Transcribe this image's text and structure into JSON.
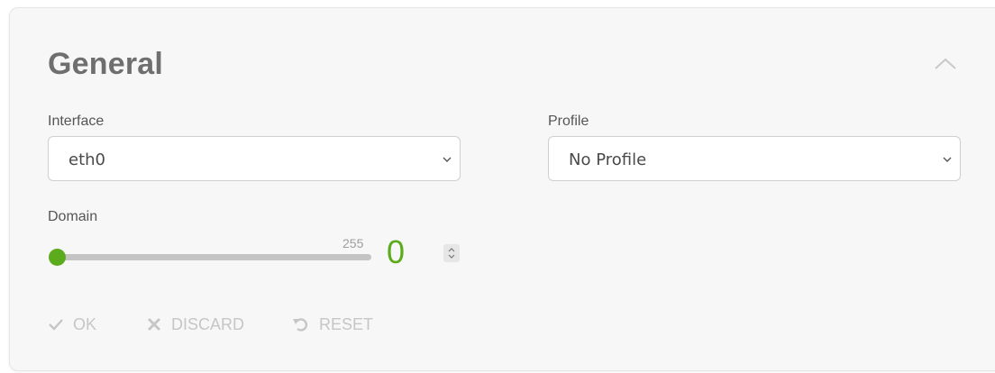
{
  "section": {
    "title": "General"
  },
  "icons": {
    "collapse": "chevron-up-icon",
    "dropdown": "chevron-down-icon",
    "stepper": "up-down-stepper-icon",
    "ok": "checkmark-icon",
    "discard": "x-icon",
    "reset": "undo-icon"
  },
  "interface_field": {
    "label": "Interface",
    "value": "eth0"
  },
  "profile_field": {
    "label": "Profile",
    "value": "No Profile"
  },
  "domain_field": {
    "label": "Domain",
    "max": "255",
    "value": "0",
    "fraction": 0
  },
  "actions": {
    "ok": "OK",
    "discard": "DISCARD",
    "reset": "RESET"
  },
  "colors": {
    "accent": "#5cab1c",
    "disabled": "#c6c6c6",
    "title": "#6f6f6f"
  }
}
